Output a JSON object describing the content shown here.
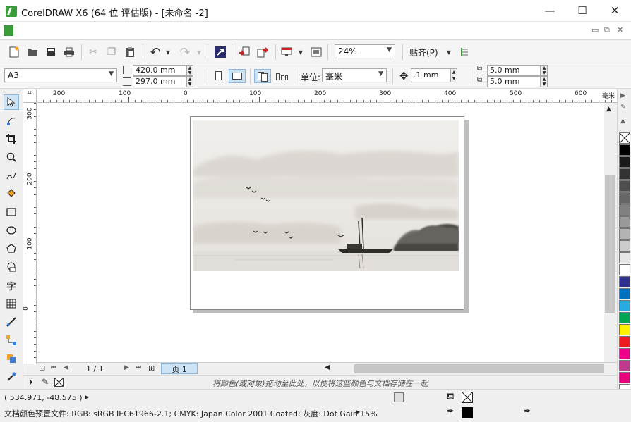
{
  "window": {
    "title": "CorelDRAW X6 (64 位 评估版) - [未命名 -2]",
    "minimize_glyph": "—",
    "maximize_glyph": "☐",
    "close_glyph": "✕"
  },
  "menubar": {
    "mdi_minimize": "▭",
    "mdi_restore": "⧉",
    "mdi_close": "✕"
  },
  "toolbar": {
    "icons": [
      "new-icon",
      "open-icon",
      "save-icon",
      "print-icon",
      "cut-icon",
      "copy-icon",
      "paste-icon",
      "undo-icon",
      "redo-icon",
      "launcher-icon",
      "import-icon",
      "export-icon",
      "publish-icon",
      "fullscreen-icon",
      "snap-options-icon"
    ],
    "zoom": "24%",
    "snap_label": "贴齐(P)"
  },
  "propbar": {
    "paper_size": "A3",
    "width": "420.0 mm",
    "height": "297.0 mm",
    "unit_label": "单位:",
    "unit_value": "毫米",
    "nudge": ".1 mm",
    "dup_x": "5.0 mm",
    "dup_y": "5.0 mm"
  },
  "ruler": {
    "top_labels": [
      "200",
      "100",
      "0",
      "100",
      "200",
      "300",
      "400",
      "500",
      "600"
    ],
    "top_unit": "毫米",
    "left_labels": [
      "300",
      "200",
      "100",
      "0"
    ]
  },
  "tools": [
    "pick-tool-icon",
    "shape-tool-icon",
    "crop-tool-icon",
    "zoom-tool-icon",
    "freehand-tool-icon",
    "smart-fill-icon",
    "rectangle-tool-icon",
    "ellipse-tool-icon",
    "polygon-tool-icon",
    "basic-shapes-icon",
    "text-tool-icon",
    "table-tool-icon",
    "dimension-tool-icon",
    "connector-tool-icon",
    "interactive-tool-icon",
    "eyedropper-tool-icon"
  ],
  "text_tool_glyph": "字",
  "pagenav": {
    "count": "1 / 1",
    "tab": "页 1"
  },
  "colorbar": {
    "hint": "将颜色(或对象)拖动至此处，以便将这些颜色与文档存储在一起"
  },
  "palette": {
    "colors": [
      "#000000",
      "#1a1a1a",
      "#333333",
      "#4d4d4d",
      "#666666",
      "#808080",
      "#999999",
      "#b3b3b3",
      "#cccccc",
      "#e6e6e6",
      "#ffffff",
      "#2e3192",
      "#0071bc",
      "#29abe2",
      "#00a651",
      "#fff200",
      "#ed1c24",
      "#ec008c",
      "#c0398e",
      "#e6007e",
      "#ffffff"
    ]
  },
  "status": {
    "coords": "( 534.971, -48.575 )",
    "color_profile": "文档颜色预置文件: RGB: sRGB IEC61966-2.1; CMYK: Japan Color 2001 Coated; 灰度: Dot Gain 15%"
  }
}
